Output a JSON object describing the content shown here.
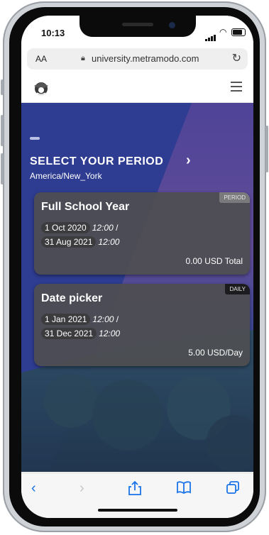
{
  "status_bar": {
    "time": "10:13"
  },
  "browser": {
    "aa_label": "AA",
    "url": "university.metramodo.com"
  },
  "site": {
    "logo_icon": "graduation-cap-logo",
    "menu_icon": "hamburger-menu-icon"
  },
  "period": {
    "title": "SELECT YOUR PERIOD",
    "arrow_icon": "chevron-right-icon",
    "timezone": "America/New_York"
  },
  "cards": [
    {
      "title": "Full School Year",
      "badge": "PERIOD",
      "badge_color": "#7a7a7d",
      "start_date": "1 Oct 2020",
      "start_time": "12:00",
      "sep": "/",
      "end_date": "31 Aug 2021",
      "end_time": "12:00",
      "price": "0.00 USD Total"
    },
    {
      "title": "Date picker",
      "badge": "DAILY",
      "badge_color": "#1c1c1e",
      "start_date": "1 Jan 2021",
      "start_time": "12:00",
      "sep": "/",
      "end_date": "31 Dec 2021",
      "end_time": "12:00",
      "price": "5.00 USD/Day"
    }
  ],
  "toolbar": {
    "back_icon": "back-arrow-icon",
    "forward_icon": "forward-arrow-icon",
    "share_icon": "share-icon",
    "bookmarks_icon": "bookmarks-icon",
    "tabs_icon": "tabs-icon"
  },
  "colors": {
    "hero_blue": "#2e3d91",
    "card_bg": "#4e4e50",
    "toolbar_blue": "#1a73e8"
  }
}
